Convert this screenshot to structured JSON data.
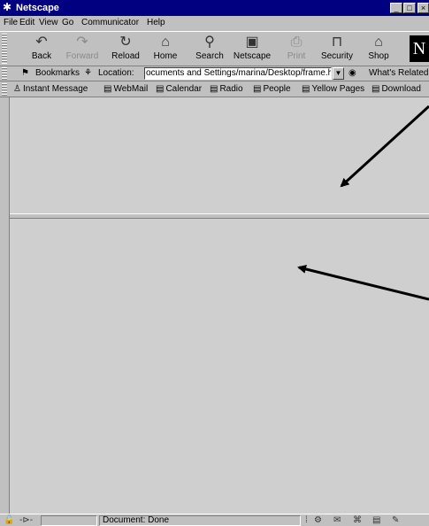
{
  "window": {
    "title": "Netscape",
    "controls": [
      "_",
      "□",
      "×"
    ]
  },
  "menu": [
    "File",
    "Edit",
    "View",
    "Go",
    "Communicator",
    "Help"
  ],
  "nav_buttons": [
    {
      "label": "Back",
      "icon": "back-arrow-icon",
      "enabled": true
    },
    {
      "label": "Forward",
      "icon": "forward-arrow-icon",
      "enabled": false
    },
    {
      "label": "Reload",
      "icon": "reload-icon",
      "enabled": true
    },
    {
      "label": "Home",
      "icon": "home-icon",
      "enabled": true
    },
    {
      "label": "Search",
      "icon": "search-icon",
      "enabled": true
    },
    {
      "label": "Netscape",
      "icon": "netscape-icon",
      "enabled": true
    },
    {
      "label": "Print",
      "icon": "print-icon",
      "enabled": false
    },
    {
      "label": "Security",
      "icon": "lock-icon",
      "enabled": true
    },
    {
      "label": "Shop",
      "icon": "shop-icon",
      "enabled": true
    }
  ],
  "location": {
    "bookmarks_label": "Bookmarks",
    "location_label": "Location:",
    "url": "ocuments and Settings/marina/Desktop/frame.html",
    "whats_related": "What's Related"
  },
  "personal_toolbar": [
    "Instant Message",
    "WebMail",
    "Calendar",
    "Radio",
    "People",
    "Yellow Pages",
    "Download"
  ],
  "status": {
    "text": "Document: Done"
  },
  "colors": {
    "chrome": "#c0c0c0",
    "frame": "#cfcfcf",
    "titlebar": "#000080",
    "arrow": "#000000"
  }
}
